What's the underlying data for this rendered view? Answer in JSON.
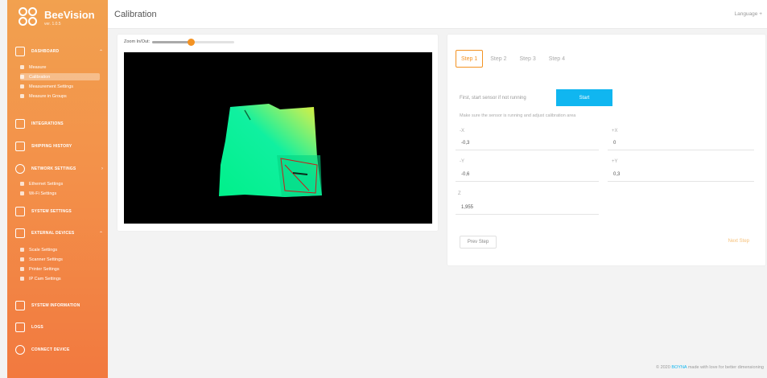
{
  "app": {
    "name": "BeeVision",
    "version": "ver. 1.0.5"
  },
  "header": {
    "title": "Calibration",
    "language": "Language +"
  },
  "sidebar": {
    "sections": [
      {
        "label": "Dashboard",
        "items": [
          {
            "label": "Measure"
          },
          {
            "label": "Calibration"
          },
          {
            "label": "Measurement Settings"
          },
          {
            "label": "Measure in Groups"
          }
        ]
      },
      {
        "label": "Integrations"
      },
      {
        "label": "Shipping History"
      },
      {
        "label": "Network Settings",
        "items": [
          {
            "label": "Ethernet Settings"
          },
          {
            "label": "Wi-Fi Settings"
          }
        ]
      },
      {
        "label": "System Settings"
      },
      {
        "label": "External Devices",
        "items": [
          {
            "label": "Scale Settings"
          },
          {
            "label": "Scanner Settings"
          },
          {
            "label": "Printer Settings"
          },
          {
            "label": "IP Cam Settings"
          }
        ]
      },
      {
        "label": "System Information"
      },
      {
        "label": "Logs"
      },
      {
        "label": "Connect Device"
      }
    ]
  },
  "viewer": {
    "zoom_label": "Zoom In/Out:",
    "zoom_level": 0.47
  },
  "calibration": {
    "steps": [
      "Step 1",
      "Step 2",
      "Step 3",
      "Step 4"
    ],
    "active_step": 0,
    "sensor_hint": "First, start sensor if not running",
    "start_label": "Start",
    "calib_hint": "Make sure the sensor is running and adjust calibration area",
    "fields": {
      "minus_x": {
        "label": "-X",
        "value": "-0,3"
      },
      "plus_x": {
        "label": "+X",
        "value": "0"
      },
      "minus_y": {
        "label": "-Y",
        "value": "-0,6"
      },
      "plus_y": {
        "label": "+Y",
        "value": "0,3"
      },
      "z": {
        "label": "Z",
        "value": "1,955"
      }
    },
    "prev_label": "Prev Step",
    "next_label": "Next Step"
  },
  "footer": {
    "prefix": "© 2020",
    "brand": "BOYNA",
    "suffix": "made with love for better dimensioning"
  }
}
